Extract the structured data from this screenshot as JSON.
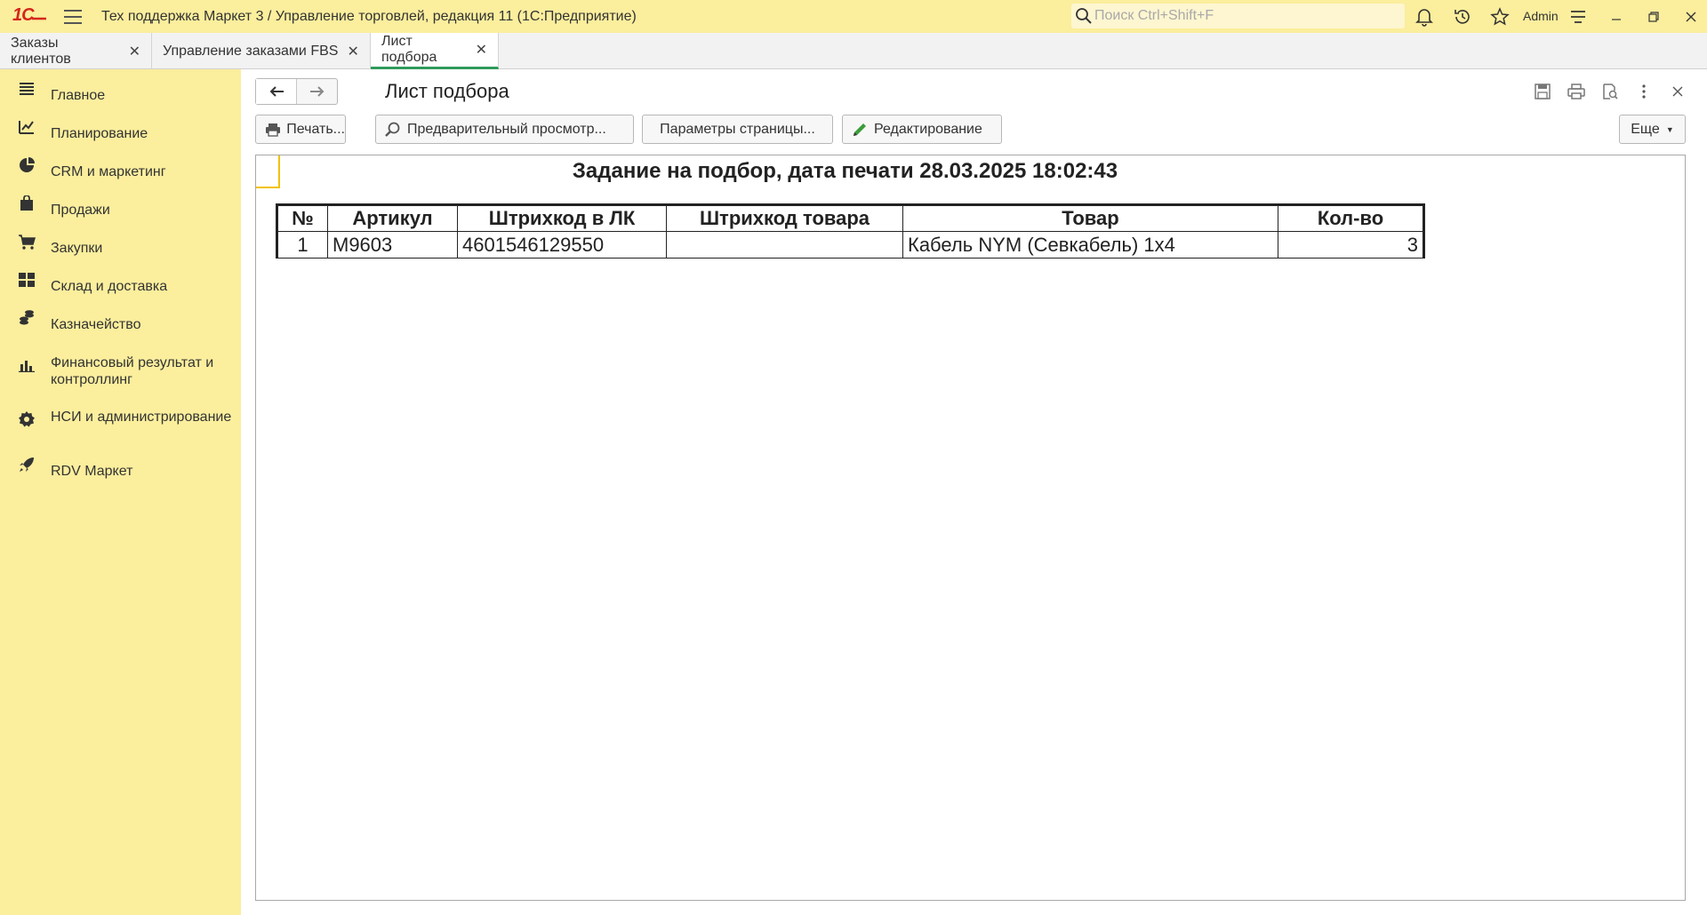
{
  "app": {
    "title": "Тех поддержка Маркет 3 / Управление торговлей, редакция 11  (1С:Предприятие)",
    "logo_text": "1С",
    "search_placeholder": "Поиск Ctrl+Shift+F",
    "user": "Admin"
  },
  "tabs": [
    {
      "label": "Заказы клиентов",
      "active": false
    },
    {
      "label": "Управление заказами FBS",
      "active": false
    },
    {
      "label": "Лист подбора",
      "active": true
    }
  ],
  "sidebar": {
    "items": [
      {
        "label": "Главное",
        "icon": "menu-lines-icon"
      },
      {
        "label": "Планирование",
        "icon": "planning-icon"
      },
      {
        "label": "CRM и маркетинг",
        "icon": "pie-icon"
      },
      {
        "label": "Продажи",
        "icon": "bag-icon"
      },
      {
        "label": "Закупки",
        "icon": "cart-icon"
      },
      {
        "label": "Склад и доставка",
        "icon": "warehouse-icon"
      },
      {
        "label": "Казначейство",
        "icon": "coins-icon"
      },
      {
        "label": "Финансовый результат и контроллинг",
        "icon": "bar-chart-icon"
      },
      {
        "label": "НСИ и администрирование",
        "icon": "gear-icon"
      },
      {
        "label": "RDV Маркет",
        "icon": "rocket-icon"
      }
    ]
  },
  "form": {
    "title": "Лист подбора",
    "buttons": {
      "print": "Печать...",
      "preview": "Предварительный просмотр...",
      "page_params": "Параметры страницы...",
      "edit": "Редактирование",
      "more": "Еще"
    }
  },
  "document": {
    "heading": "Задание на подбор, дата печати 28.03.2025 18:02:43",
    "columns": [
      "№",
      "Артикул",
      "Штрихкод в ЛК",
      "Штрихкод товара",
      "Товар",
      "Кол-во"
    ],
    "rows": [
      {
        "n": "1",
        "article": "М9603",
        "barcode_lk": "4601546129550",
        "barcode_item": "",
        "item": "Кабель NYM (Севкабель) 1х4",
        "qty": "3"
      }
    ]
  },
  "colors": {
    "accent_yellow": "#fbee9d",
    "active_tab_underline": "#2f9a5d",
    "logo_red": "#d4261c"
  }
}
